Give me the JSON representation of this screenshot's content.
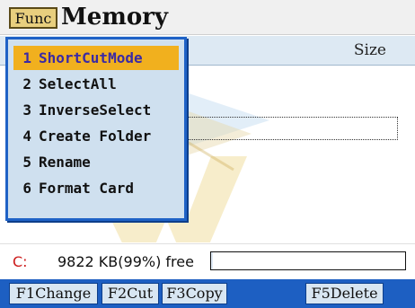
{
  "title_bar": {
    "func_label": "Func",
    "title": "Memory"
  },
  "columns": {
    "size_label": "Size"
  },
  "menu": {
    "items": [
      {
        "num": "1",
        "label": "ShortCutMode",
        "selected": true
      },
      {
        "num": "2",
        "label": "SelectAll"
      },
      {
        "num": "3",
        "label": "InverseSelect"
      },
      {
        "num": "4",
        "label": "Create Folder"
      },
      {
        "num": "5",
        "label": "Rename"
      },
      {
        "num": "6",
        "label": "Format Card"
      }
    ]
  },
  "status": {
    "drive": "C:",
    "free_text": "9822 KB(99%) free",
    "used_fraction": 0.01
  },
  "function_keys": {
    "f1": "F1Change",
    "f2": "F2Cut",
    "f3": "F3Copy",
    "f5": "F5Delete"
  },
  "colors": {
    "menu_border": "#1f62c6",
    "menu_bg": "#cfe0ef",
    "selected_bg": "#f1b01e",
    "selected_text": "#3b2aa4",
    "key_bar": "#1d5fc2",
    "drive_text": "#cc1a1a"
  },
  "icons": {
    "watermark": "w-logo-watermark"
  }
}
